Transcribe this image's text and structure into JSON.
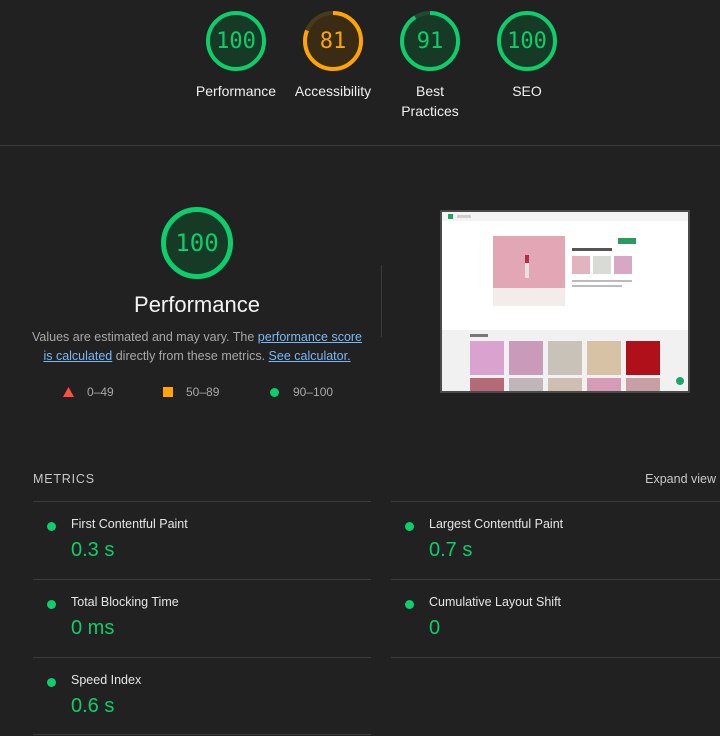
{
  "top_scores": [
    {
      "label": "Performance",
      "score": "100",
      "status": "pass",
      "fraction": 1.0
    },
    {
      "label": "Accessibility",
      "score": "81",
      "status": "average",
      "fraction": 0.81
    },
    {
      "label": "Best Practices",
      "score": "91",
      "status": "pass",
      "fraction": 0.91
    },
    {
      "label": "SEO",
      "score": "100",
      "status": "pass",
      "fraction": 1.0
    }
  ],
  "performance": {
    "score": "100",
    "title": "Performance",
    "desc_text1": "Values are estimated and may vary. The ",
    "desc_link1": "performance score is calculated",
    "desc_text2": " directly from these metrics. ",
    "desc_link2": "See calculator."
  },
  "legend": [
    {
      "shape": "triangle",
      "range": "0–49",
      "color": "#ff4e42"
    },
    {
      "shape": "square",
      "range": "50–89",
      "color": "#ffa400"
    },
    {
      "shape": "circle",
      "range": "90–100",
      "color": "#0cce6b"
    }
  ],
  "metrics_section": {
    "heading": "METRICS",
    "expand_label": "Expand view"
  },
  "metrics": [
    {
      "name": "First Contentful Paint",
      "value": "0.3 s"
    },
    {
      "name": "Largest Contentful Paint",
      "value": "0.7 s"
    },
    {
      "name": "Total Blocking Time",
      "value": "0 ms"
    },
    {
      "name": "Cumulative Layout Shift",
      "value": "0"
    },
    {
      "name": "Speed Index",
      "value": "0.6 s"
    }
  ],
  "colors": {
    "pass": "#0cce6b",
    "average": "#ffa400",
    "fail": "#ff4e42",
    "background": "#212121",
    "link": "#7ab7f5"
  }
}
